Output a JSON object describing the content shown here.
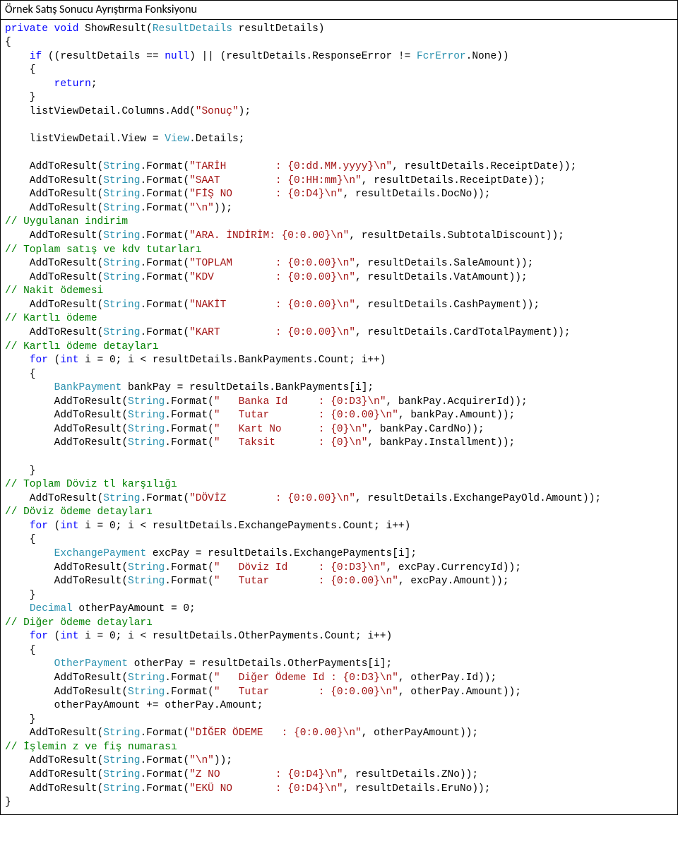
{
  "title": "Örnek Satış Sonucu Ayrıştırma Fonksiyonu",
  "code": {
    "l1a": "private",
    "l1b": "void",
    "l1c": " ShowResult(",
    "l1d": "ResultDetails",
    "l1e": " resultDetails)",
    "l2": "{",
    "l3a": "    ",
    "l3b": "if",
    "l3c": " ((resultDetails == ",
    "l3d": "null",
    "l3e": ") || (resultDetails.ResponseError != ",
    "l3f": "FcrError",
    "l3g": ".None))",
    "l4": "    {",
    "l5a": "        ",
    "l5b": "return",
    "l5c": ";",
    "l6": "    }",
    "l7a": "    listViewDetail.Columns.Add(",
    "l7b": "\"Sonuç\"",
    "l7c": ");",
    "l8": "",
    "l9a": "    listViewDetail.View = ",
    "l9b": "View",
    "l9c": ".Details;",
    "l10": "",
    "l11a": "    AddToResult(",
    "l11b": "String",
    "l11c": ".Format(",
    "l11d": "\"TARİH        : {0:dd.MM.yyyy}\\n\"",
    "l11e": ", resultDetails.ReceiptDate));",
    "l12a": "    AddToResult(",
    "l12b": "String",
    "l12c": ".Format(",
    "l12d": "\"SAAT         : {0:HH:mm}\\n\"",
    "l12e": ", resultDetails.ReceiptDate));",
    "l13a": "    AddToResult(",
    "l13b": "String",
    "l13c": ".Format(",
    "l13d": "\"FİŞ NO       : {0:D4}\\n\"",
    "l13e": ", resultDetails.DocNo));",
    "l14a": "    AddToResult(",
    "l14b": "String",
    "l14c": ".Format(",
    "l14d": "\"\\n\"",
    "l14e": "));",
    "l15": "// Uygulanan indirim",
    "l16a": "    AddToResult(",
    "l16b": "String",
    "l16c": ".Format(",
    "l16d": "\"ARA. İNDİRİM: {0:0.00}\\n\"",
    "l16e": ", resultDetails.SubtotalDiscount));",
    "l17": "// Toplam satış ve kdv tutarları",
    "l18a": "    AddToResult(",
    "l18b": "String",
    "l18c": ".Format(",
    "l18d": "\"TOPLAM       : {0:0.00}\\n\"",
    "l18e": ", resultDetails.SaleAmount));",
    "l19a": "    AddToResult(",
    "l19b": "String",
    "l19c": ".Format(",
    "l19d": "\"KDV          : {0:0.00}\\n\"",
    "l19e": ", resultDetails.VatAmount));",
    "l20": "// Nakit ödemesi",
    "l21a": "    AddToResult(",
    "l21b": "String",
    "l21c": ".Format(",
    "l21d": "\"NAKİT        : {0:0.00}\\n\"",
    "l21e": ", resultDetails.CashPayment));",
    "l22": "// Kartlı ödeme",
    "l23a": "    AddToResult(",
    "l23b": "String",
    "l23c": ".Format(",
    "l23d": "\"KART         : {0:0.00}\\n\"",
    "l23e": ", resultDetails.CardTotalPayment));",
    "l24": "// Kartlı ödeme detayları",
    "l25a": "    ",
    "l25b": "for",
    "l25c": " (",
    "l25d": "int",
    "l25e": " i = 0; i < resultDetails.BankPayments.Count; i++)",
    "l26": "    {",
    "l27a": "        ",
    "l27b": "BankPayment",
    "l27c": " bankPay = resultDetails.BankPayments[i];",
    "l28a": "        AddToResult(",
    "l28b": "String",
    "l28c": ".Format(",
    "l28d": "\"   Banka Id     : {0:D3}\\n\"",
    "l28e": ", bankPay.AcquirerId));",
    "l29a": "        AddToResult(",
    "l29b": "String",
    "l29c": ".Format(",
    "l29d": "\"   Tutar        : {0:0.00}\\n\"",
    "l29e": ", bankPay.Amount));",
    "l30a": "        AddToResult(",
    "l30b": "String",
    "l30c": ".Format(",
    "l30d": "\"   Kart No      : {0}\\n\"",
    "l30e": ", bankPay.CardNo));",
    "l31a": "        AddToResult(",
    "l31b": "String",
    "l31c": ".Format(",
    "l31d": "\"   Taksit       : {0}\\n\"",
    "l31e": ", bankPay.Installment));",
    "l32": "",
    "l33": "    }",
    "l34": "// Toplam Döviz tl karşılığı",
    "l35a": "    AddToResult(",
    "l35b": "String",
    "l35c": ".Format(",
    "l35d": "\"DÖVİZ        : {0:0.00}\\n\"",
    "l35e": ", resultDetails.ExchangePayOld.Amount));",
    "l36": "// Döviz ödeme detayları",
    "l37a": "    ",
    "l37b": "for",
    "l37c": " (",
    "l37d": "int",
    "l37e": " i = 0; i < resultDetails.ExchangePayments.Count; i++)",
    "l38": "    {",
    "l39a": "        ",
    "l39b": "ExchangePayment",
    "l39c": " excPay = resultDetails.ExchangePayments[i];",
    "l40a": "        AddToResult(",
    "l40b": "String",
    "l40c": ".Format(",
    "l40d": "\"   Döviz Id     : {0:D3}\\n\"",
    "l40e": ", excPay.CurrencyId));",
    "l41a": "        AddToResult(",
    "l41b": "String",
    "l41c": ".Format(",
    "l41d": "\"   Tutar        : {0:0.00}\\n\"",
    "l41e": ", excPay.Amount));",
    "l42": "    }",
    "l43a": "    ",
    "l43b": "Decimal",
    "l43c": " otherPayAmount = 0;",
    "l44": "// Diğer ödeme detayları",
    "l45a": "    ",
    "l45b": "for",
    "l45c": " (",
    "l45d": "int",
    "l45e": " i = 0; i < resultDetails.OtherPayments.Count; i++)",
    "l46": "    {",
    "l47a": "        ",
    "l47b": "OtherPayment",
    "l47c": " otherPay = resultDetails.OtherPayments[i];",
    "l48a": "        AddToResult(",
    "l48b": "String",
    "l48c": ".Format(",
    "l48d": "\"   Diğer Ödeme Id : {0:D3}\\n\"",
    "l48e": ", otherPay.Id));",
    "l49a": "        AddToResult(",
    "l49b": "String",
    "l49c": ".Format(",
    "l49d": "\"   Tutar        : {0:0.00}\\n\"",
    "l49e": ", otherPay.Amount));",
    "l50": "        otherPayAmount += otherPay.Amount;",
    "l51": "    }",
    "l52a": "    AddToResult(",
    "l52b": "String",
    "l52c": ".Format(",
    "l52d": "\"DİĞER ÖDEME   : {0:0.00}\\n\"",
    "l52e": ", otherPayAmount));",
    "l53": "// İşlemin z ve fiş numarası",
    "l54a": "    AddToResult(",
    "l54b": "String",
    "l54c": ".Format(",
    "l54d": "\"\\n\"",
    "l54e": "));",
    "l55a": "    AddToResult(",
    "l55b": "String",
    "l55c": ".Format(",
    "l55d": "\"Z NO         : {0:D4}\\n\"",
    "l55e": ", resultDetails.ZNo));",
    "l56a": "    AddToResult(",
    "l56b": "String",
    "l56c": ".Format(",
    "l56d": "\"EKÜ NO       : {0:D4}\\n\"",
    "l56e": ", resultDetails.EruNo));",
    "l57": "}"
  }
}
